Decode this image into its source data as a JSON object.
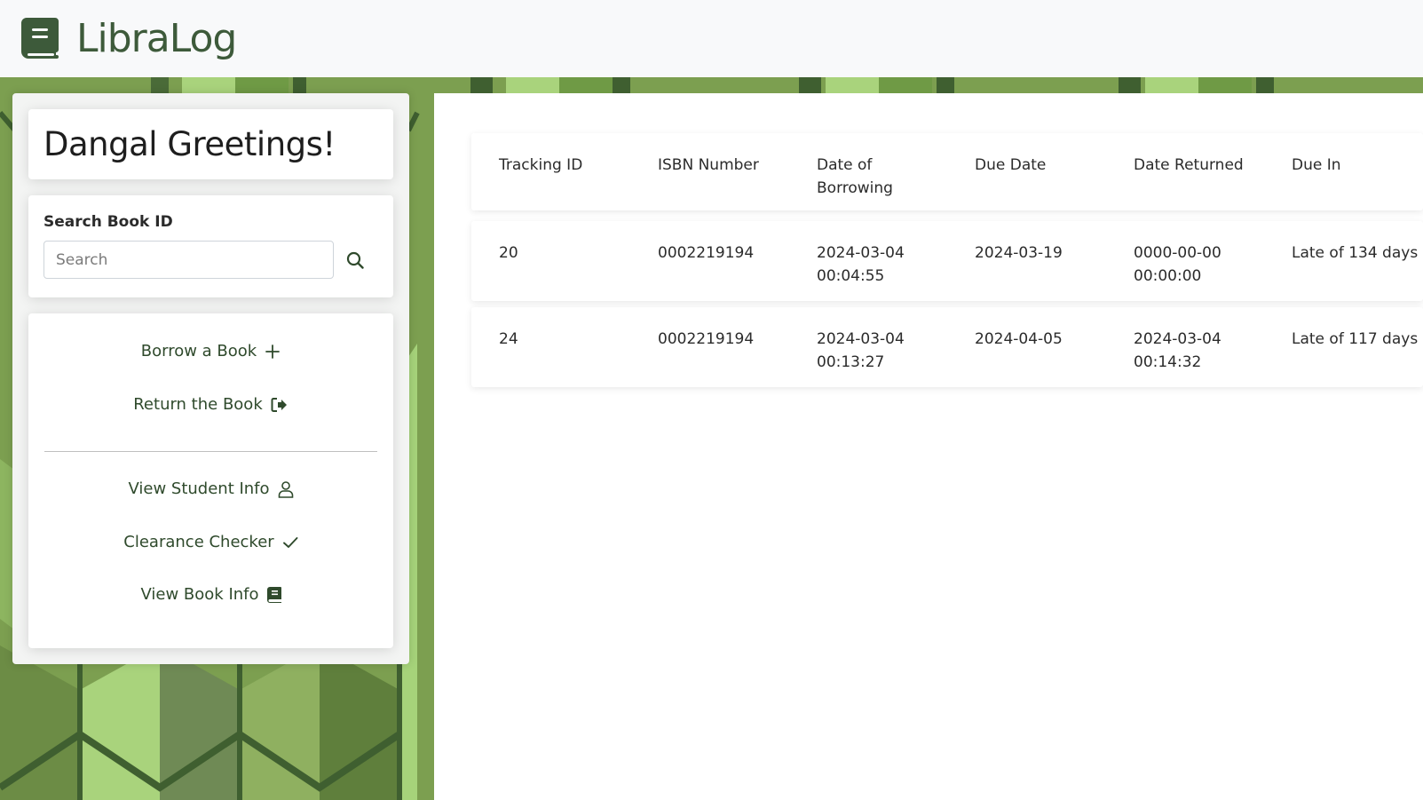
{
  "app": {
    "name": "LibraLog",
    "icon": "book-icon"
  },
  "colors": {
    "brand": "#3d5a3a",
    "menu_text": "#2f4a2c",
    "background_green": "#7a9e4e"
  },
  "sidebar": {
    "greeting": "Dangal Greetings!",
    "search": {
      "label": "Search Book ID",
      "placeholder": "Search",
      "value": "",
      "icon": "search-icon"
    },
    "menu": [
      {
        "label": "Borrow a Book",
        "icon": "plus-icon"
      },
      {
        "label": "Return the Book",
        "icon": "sign-out-icon"
      },
      {
        "label": "View Student Info",
        "icon": "user-icon"
      },
      {
        "label": "Clearance Checker",
        "icon": "check-icon"
      },
      {
        "label": "View Book Info",
        "icon": "book-icon"
      }
    ]
  },
  "table": {
    "columns": [
      "Tracking ID",
      "ISBN Number",
      "Date of Borrowing",
      "Due Date",
      "Date Returned",
      "Due In"
    ],
    "rows": [
      {
        "tracking_id": "20",
        "isbn": "0002219194",
        "date_borrowed": "2024-03-04 00:04:55",
        "due_date": "2024-03-19",
        "date_returned": "0000-00-00 00:00:00",
        "due_in": "Late of 134 days"
      },
      {
        "tracking_id": "24",
        "isbn": "0002219194",
        "date_borrowed": "2024-03-04 00:13:27",
        "due_date": "2024-04-05",
        "date_returned": "2024-03-04 00:14:32",
        "due_in": "Late of 117 days"
      }
    ]
  }
}
